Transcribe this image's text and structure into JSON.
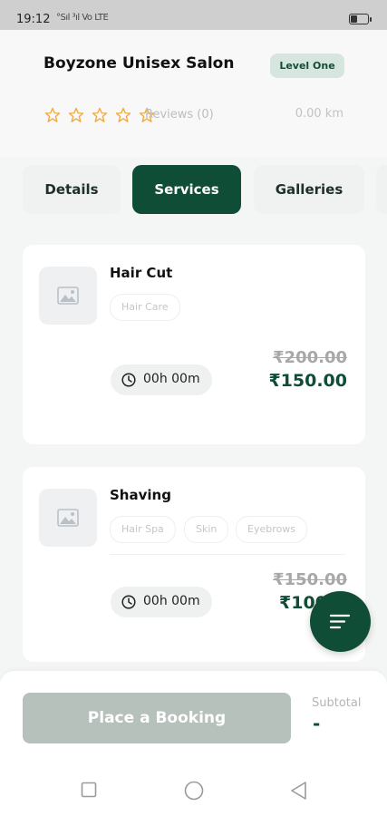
{
  "status_bar": {
    "time": "19:12",
    "network": "°Sıl ³ıl Vo LTE"
  },
  "salon": {
    "name": "Boyzone Unisex Salon",
    "level": "Level One",
    "rating": 0,
    "reviews_text": "Reviews (0)",
    "distance": "0.00 km"
  },
  "tabs": [
    {
      "label": "Details",
      "active": false
    },
    {
      "label": "Services",
      "active": true
    },
    {
      "label": "Galleries",
      "active": false
    }
  ],
  "services": [
    {
      "name": "Hair Cut",
      "tags": [
        "Hair Care"
      ],
      "duration": "00h 00m",
      "original_price": "₹200.00",
      "price": "₹150.00"
    },
    {
      "name": "Shaving",
      "tags": [
        "Hair Spa",
        "Skin",
        "Eyebrows"
      ],
      "duration": "00h 00m",
      "original_price": "₹150.00",
      "price": "₹100"
    }
  ],
  "booking": {
    "button_label": "Place a Booking",
    "subtotal_label": "Subtotal",
    "subtotal_value": "-"
  },
  "colors": {
    "primary": "#0f4d36",
    "star": "#f2a93b",
    "badge_bg": "#d6e6df"
  },
  "icons": {
    "image_placeholder": "image-icon",
    "clock": "clock-icon",
    "filter": "filter-icon",
    "star": "star-outline-icon",
    "nav": [
      "square-icon",
      "circle-icon",
      "triangle-back-icon"
    ]
  }
}
